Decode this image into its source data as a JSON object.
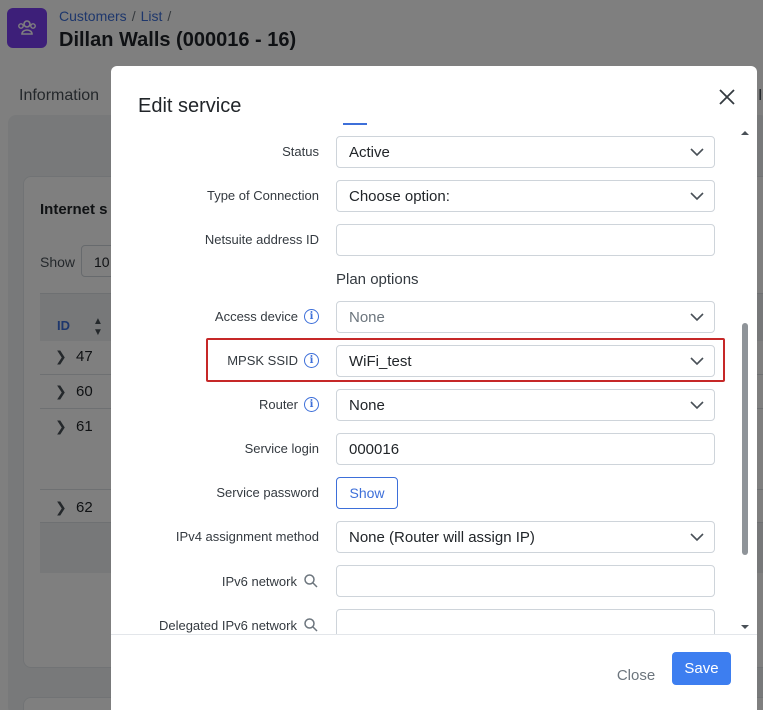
{
  "page": {
    "breadcrumb": [
      "Customers",
      "List"
    ],
    "breadcrumb_sep": "/",
    "title": "Dillan Walls (000016 - 16)",
    "tab_visible": "Information",
    "card_title": "Internet s",
    "show_label": "Show",
    "show_value": "10",
    "table": {
      "id_header": "ID",
      "rows": [
        "47",
        "60",
        "61",
        "62"
      ]
    }
  },
  "modal": {
    "title": "Edit service",
    "fields": {
      "status": {
        "label": "Status",
        "value": "Active"
      },
      "type_of_connection": {
        "label": "Type of Connection",
        "value": "Choose option:"
      },
      "netsuite_address_id": {
        "label": "Netsuite address ID",
        "value": ""
      },
      "plan_options_heading": "Plan options",
      "access_device": {
        "label": "Access device",
        "value": "None"
      },
      "mpsk_ssid": {
        "label": "MPSK SSID",
        "value": "WiFi_test"
      },
      "router": {
        "label": "Router",
        "value": "None"
      },
      "service_login": {
        "label": "Service login",
        "value": "000016"
      },
      "service_password": {
        "label": "Service password",
        "button": "Show"
      },
      "ipv4_assignment_method": {
        "label": "IPv4 assignment method",
        "value": "None (Router will assign IP)"
      },
      "ipv6_network": {
        "label": "IPv6 network",
        "value": ""
      },
      "delegated_ipv6_network": {
        "label": "Delegated IPv6 network",
        "value": ""
      }
    },
    "footer": {
      "close_label": "Close",
      "save_label": "Save"
    }
  },
  "colors": {
    "accent": "#3d7ef0",
    "highlight": "#c62828",
    "app_icon": "#7b3ff2"
  }
}
